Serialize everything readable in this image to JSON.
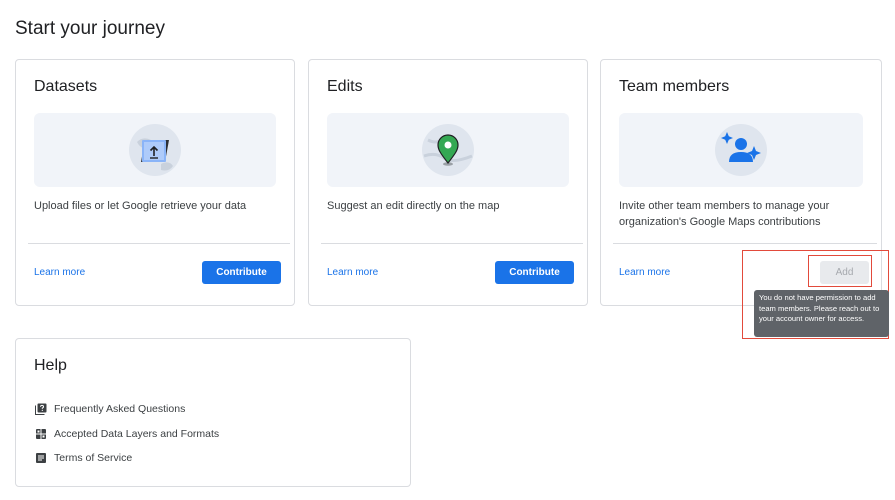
{
  "page": {
    "title": "Start your journey"
  },
  "cards": {
    "datasets": {
      "title": "Datasets",
      "description": "Upload files or let Google retrieve your data",
      "learn_more": "Learn more",
      "action": "Contribute",
      "icon": "upload-laptop-icon"
    },
    "edits": {
      "title": "Edits",
      "description": "Suggest an edit directly on the map",
      "learn_more": "Learn more",
      "action": "Contribute",
      "icon": "map-pin-icon"
    },
    "team": {
      "title": "Team members",
      "description": "Invite other team members to manage your organization's Google Maps contributions",
      "learn_more": "Learn more",
      "action": "Add",
      "action_disabled": true,
      "icon": "team-sparkle-icon",
      "tooltip": "You do not have permission to add team members. Please reach out to your account owner for access."
    }
  },
  "help": {
    "title": "Help",
    "items": [
      {
        "label": "Frequently Asked Questions",
        "icon": "faq-book-icon"
      },
      {
        "label": "Accepted Data Layers and Formats",
        "icon": "grid-icon"
      },
      {
        "label": "Terms of Service",
        "icon": "document-icon"
      }
    ]
  },
  "colors": {
    "primary": "#1a73e8",
    "highlight": "#e24a3b",
    "tooltip_bg": "#5f6368",
    "illustration_bg": "#f1f4f9"
  }
}
